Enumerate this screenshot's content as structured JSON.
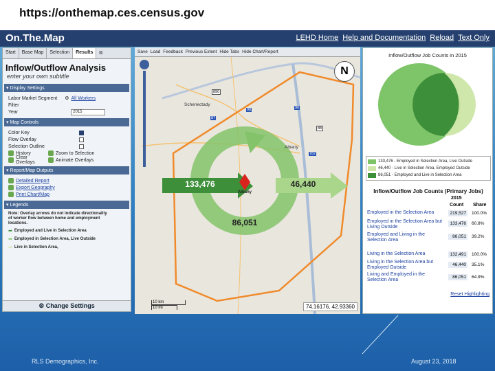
{
  "browser": {
    "url": "https://onthemap.ces.census.gov"
  },
  "header": {
    "logo": "On.The.Map",
    "links": [
      "LEHD Home",
      "Help and Documentation",
      "Reload",
      "Text Only"
    ]
  },
  "left_panel": {
    "tabs": [
      "Start",
      "Base Map",
      "Selection",
      "Results"
    ],
    "title": "Inflow/Outflow Analysis",
    "subtitle": "enter your own subtitle",
    "display_settings": {
      "header": "Display Settings",
      "segment_label": "Labor Market Segment",
      "filter_label": "Filter",
      "segment_value": "All Workers",
      "year_label": "Year",
      "year_value": "2015"
    },
    "map_controls": {
      "header": "Map Controls",
      "color_key": "Color Key",
      "flow_overlay": "Flow Overlay",
      "selection_outline": "Selection Outline",
      "history": "History",
      "zoom": "Zoom to Selection",
      "clear": "Clear Overlays",
      "animate": "Animate Overlays"
    },
    "report_outputs": {
      "header": "Report/Map Outputs",
      "detailed": "Detailed Report",
      "export": "Export Geography",
      "print": "Print Chart/Map"
    },
    "legends": {
      "header": "Legends",
      "note": "Note: Overlay arrows do not indicate directionality of worker flow between home and employment locations.",
      "items": [
        "Employed and Live in Selection Area",
        "Employed in Selection Area, Live Outside",
        "Live in Selection Area,"
      ]
    },
    "change_settings": "Change Settings"
  },
  "toolbar": {
    "items": [
      "Save",
      "Load",
      "Feedback",
      "Previous Extent",
      "Hide Tabs",
      "Hide Chart/Report"
    ]
  },
  "map": {
    "inflow": "133,476",
    "outflow": "46,440",
    "internal": "86,051",
    "city_label": "Albany",
    "coords": "74.16176, 42.93360",
    "scale_km": "10 km",
    "scale_mi": "10 mi",
    "north": "N",
    "places": [
      "Schenectady",
      "Albany"
    ],
    "roads": [
      "890",
      "87",
      "90",
      "90",
      "787",
      "88"
    ]
  },
  "right_panel": {
    "chart_title": "Inflow/Outflow Job Counts in 2015",
    "legend": [
      {
        "label": "133,476 - Employed in Selection Area, Live Outside",
        "color": "#7ec468"
      },
      {
        "label": "46,440 - Live in Selection Area, Employed Outside",
        "color": "#cde6a8"
      },
      {
        "label": "86,051 - Employed and Live in Selection Area",
        "color": "#3d8f3a"
      }
    ],
    "table_title": "Inflow/Outflow Job Counts (Primary Jobs)",
    "table_year": "2015",
    "col_count": "Count",
    "col_share": "Share",
    "rows": [
      {
        "label": "Employed in the Selection Area",
        "count": "219,527",
        "share": "100.0%"
      },
      {
        "label": "Employed in the Selection Area but Living Outside",
        "count": "133,476",
        "share": "60.8%"
      },
      {
        "label": "Employed and Living in the Selection Area",
        "count": "86,051",
        "share": "39.2%"
      },
      {
        "label": "Living in the Selection Area",
        "count": "132,491",
        "share": "100.0%"
      },
      {
        "label": "Living in the Selection Area but Employed Outside",
        "count": "46,440",
        "share": "35.1%"
      },
      {
        "label": "Living and Employed in the Selection Area",
        "count": "86,051",
        "share": "64.9%"
      }
    ],
    "reset": "Reset Highlighting"
  },
  "footer": {
    "left": "RLS Demographics, Inc.",
    "right": "August 23, 2018"
  }
}
